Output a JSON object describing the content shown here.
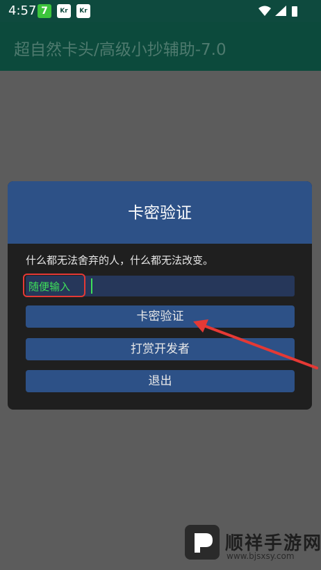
{
  "status_bar": {
    "time": "4:57",
    "notifications": [
      "7",
      "Kr",
      "Kr"
    ]
  },
  "app_bar": {
    "title": "超自然卡头/高级小抄辅助-7.0"
  },
  "dialog": {
    "title": "卡密验证",
    "message": "什么都无法舍弃的人，什么都无法改变。",
    "input_value": "随便输入",
    "buttons": {
      "verify": "卡密验证",
      "tip": "打赏开发者",
      "exit": "退出"
    }
  },
  "watermark": {
    "name": "顺祥手游网",
    "url": "www.bjsxsy.com"
  },
  "colors": {
    "app_bar": "#0c4a3c",
    "dialog_header": "#2d5187",
    "button": "#2d5187",
    "input_text": "#3ee05a",
    "annotation": "#e53935"
  }
}
